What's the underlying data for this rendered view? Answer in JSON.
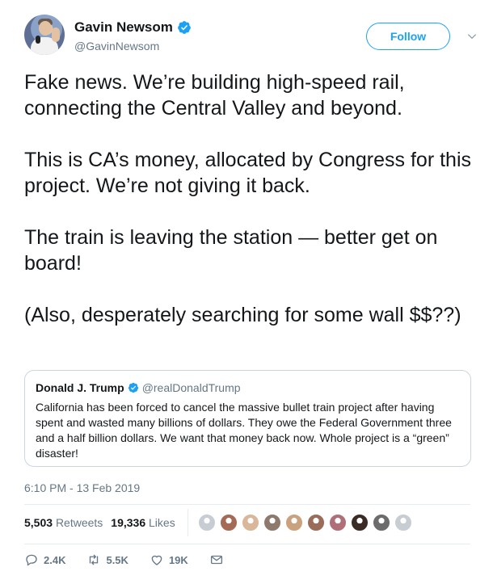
{
  "author": {
    "display_name": "Gavin Newsom",
    "handle": "@GavinNewsom",
    "verified_icon": "verified-badge-icon"
  },
  "follow_button": {
    "label": "Follow"
  },
  "tweet": {
    "paragraphs": [
      "Fake news. We’re building high-speed rail, connecting the Central Valley and beyond.",
      "This is CA’s money, allocated by Congress for this project. We’re not giving it back.",
      "The train is leaving the station — better get on board!",
      "(Also, desperately searching for some wall $$??)"
    ]
  },
  "quoted_tweet": {
    "display_name": "Donald J. Trump",
    "handle": "@realDonaldTrump",
    "text": "California has been forced to cancel the massive bullet train project after having spent and wasted many billions of dollars. They owe the Federal Government three and a half billion dollars. We want that money back now. Whole project is a “green” disaster!"
  },
  "timestamp": "6:10 PM - 13 Feb 2019",
  "stats": {
    "retweets_count": "5,503",
    "retweets_label": "Retweets",
    "likes_count": "19,336",
    "likes_label": "Likes"
  },
  "liker_faces": [
    "#c7cdd3",
    "#a46a55",
    "#d9b79a",
    "#8d7a6c",
    "#caa27e",
    "#9a6c5a",
    "#b06f78",
    "#3b2b25",
    "#6c6c6c",
    "#c7cdd3"
  ],
  "actions": {
    "reply_count": "2.4K",
    "retweet_count": "5.5K",
    "like_count": "19K"
  },
  "colors": {
    "accent": "#1da1f2",
    "secondary_text": "#657786",
    "border": "#e6ecf0"
  }
}
